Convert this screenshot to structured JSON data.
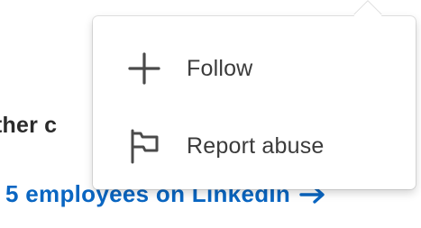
{
  "background": {
    "partial_heading": "ther c",
    "link_text": "5 employees on LinkedIn",
    "link_color": "#0a66c2"
  },
  "menu": {
    "items": [
      {
        "label": "Follow",
        "icon": "plus-icon"
      },
      {
        "label": "Report abuse",
        "icon": "flag-icon"
      }
    ]
  }
}
